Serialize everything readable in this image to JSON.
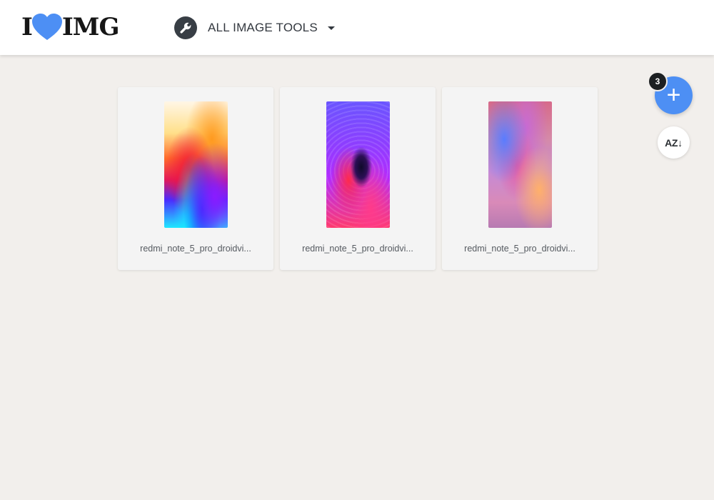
{
  "header": {
    "logo_left": "I",
    "logo_right": "IMG",
    "tools_menu_label": "ALL IMAGE TOOLS"
  },
  "files": [
    {
      "name": "redmi_note_5_pro_droidvi...",
      "thumb_icon": "wallpaper-thumbnail"
    },
    {
      "name": "redmi_note_5_pro_droidvi...",
      "thumb_icon": "wallpaper-thumbnail"
    },
    {
      "name": "redmi_note_5_pro_droidvi...",
      "thumb_icon": "wallpaper-thumbnail"
    }
  ],
  "controls": {
    "file_count": "3",
    "add_icon": "+",
    "sort_label": "AZ↓"
  },
  "colors": {
    "accent": "#4d8ff4",
    "background": "#f2efec",
    "header_bg": "#ffffff"
  }
}
